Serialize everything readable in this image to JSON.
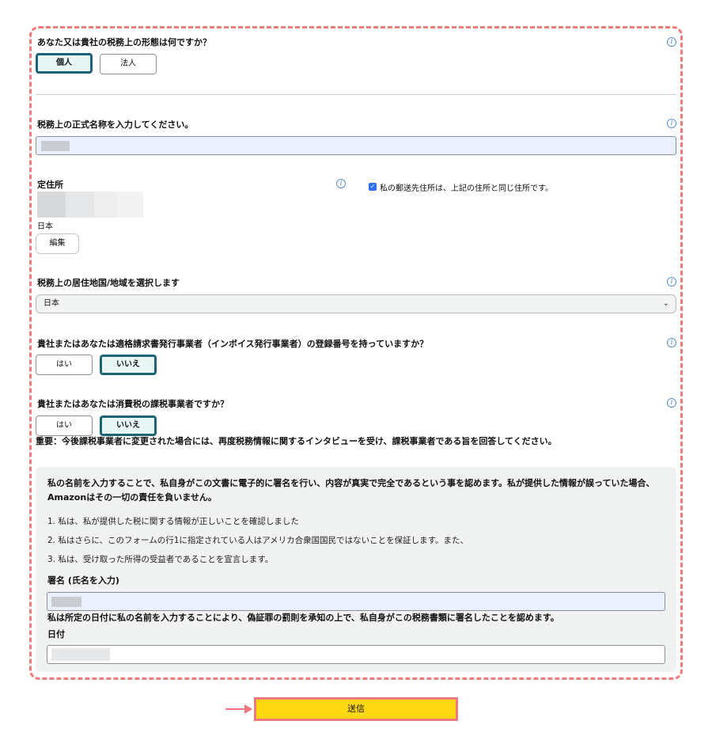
{
  "tax_form": {
    "q1": "あなた又は貴社の税務上の形態は何ですか？",
    "q1_options": [
      "個人",
      "法人"
    ],
    "q1_selected": "個人",
    "q2": "税務上の正式名称を入力してください。",
    "address_label": "定住所",
    "address_country": "日本",
    "edit_button": "編集",
    "same_address_checkbox": "私の郵送先住所は、上記の住所と同じ住所です。",
    "same_address_checked": true,
    "q3": "税務上の居住地国/地域を選択します",
    "q3_selected": "日本",
    "q4": "貴社またはあなたは適格請求書発行事業者（インボイス発行事業者）の登録番号を持っていますか？",
    "q4_options": [
      "はい",
      "いいえ"
    ],
    "q4_selected": "いいえ",
    "q5": "貴社またはあなたは消費税の課税事業者ですか？",
    "q5_options": [
      "はい",
      "いいえ"
    ],
    "q5_selected": "いいえ",
    "important_note": "重要：今後課税事業者に変更された場合には、再度税務情報に関するインタビューを受け、課税事業者である旨を回答してください。"
  },
  "signature": {
    "intro": "私の名前を入力することで、私自身がこの文書に電子的に署名を行い、内容が真実で完全であるという事を認めます。私が提供した情報が誤っていた場合、Amazonはその一切の責任を負いません。",
    "items": [
      "1. 私は、私が提供した税に関する情報が正しいことを確認しました",
      "2. 私はさらに、このフォームの行1に指定されている人はアメリカ合衆国国民ではないことを保証します。また、",
      "3. 私は、受け取った所得の受益者であることを宣言します。"
    ],
    "signature_label": "署名 (氏名を入力)",
    "declaration": "私は所定の日付に私の名前を入力することにより、偽証罪の罰則を承知の上で、私自身がこの税務書類に署名したことを認めます。",
    "date_label": "日付"
  },
  "submit_label": "送信",
  "info_glyph": "i",
  "colors": {
    "highlight_dashed": "#f27a7a",
    "selected_border": "#1c6474",
    "submit_bg": "#ffd814",
    "checkbox": "#2d6ff0"
  },
  "icons": {
    "info": "info-icon",
    "chevron": "chevron-down-icon",
    "arrow": "arrow-right-icon"
  }
}
